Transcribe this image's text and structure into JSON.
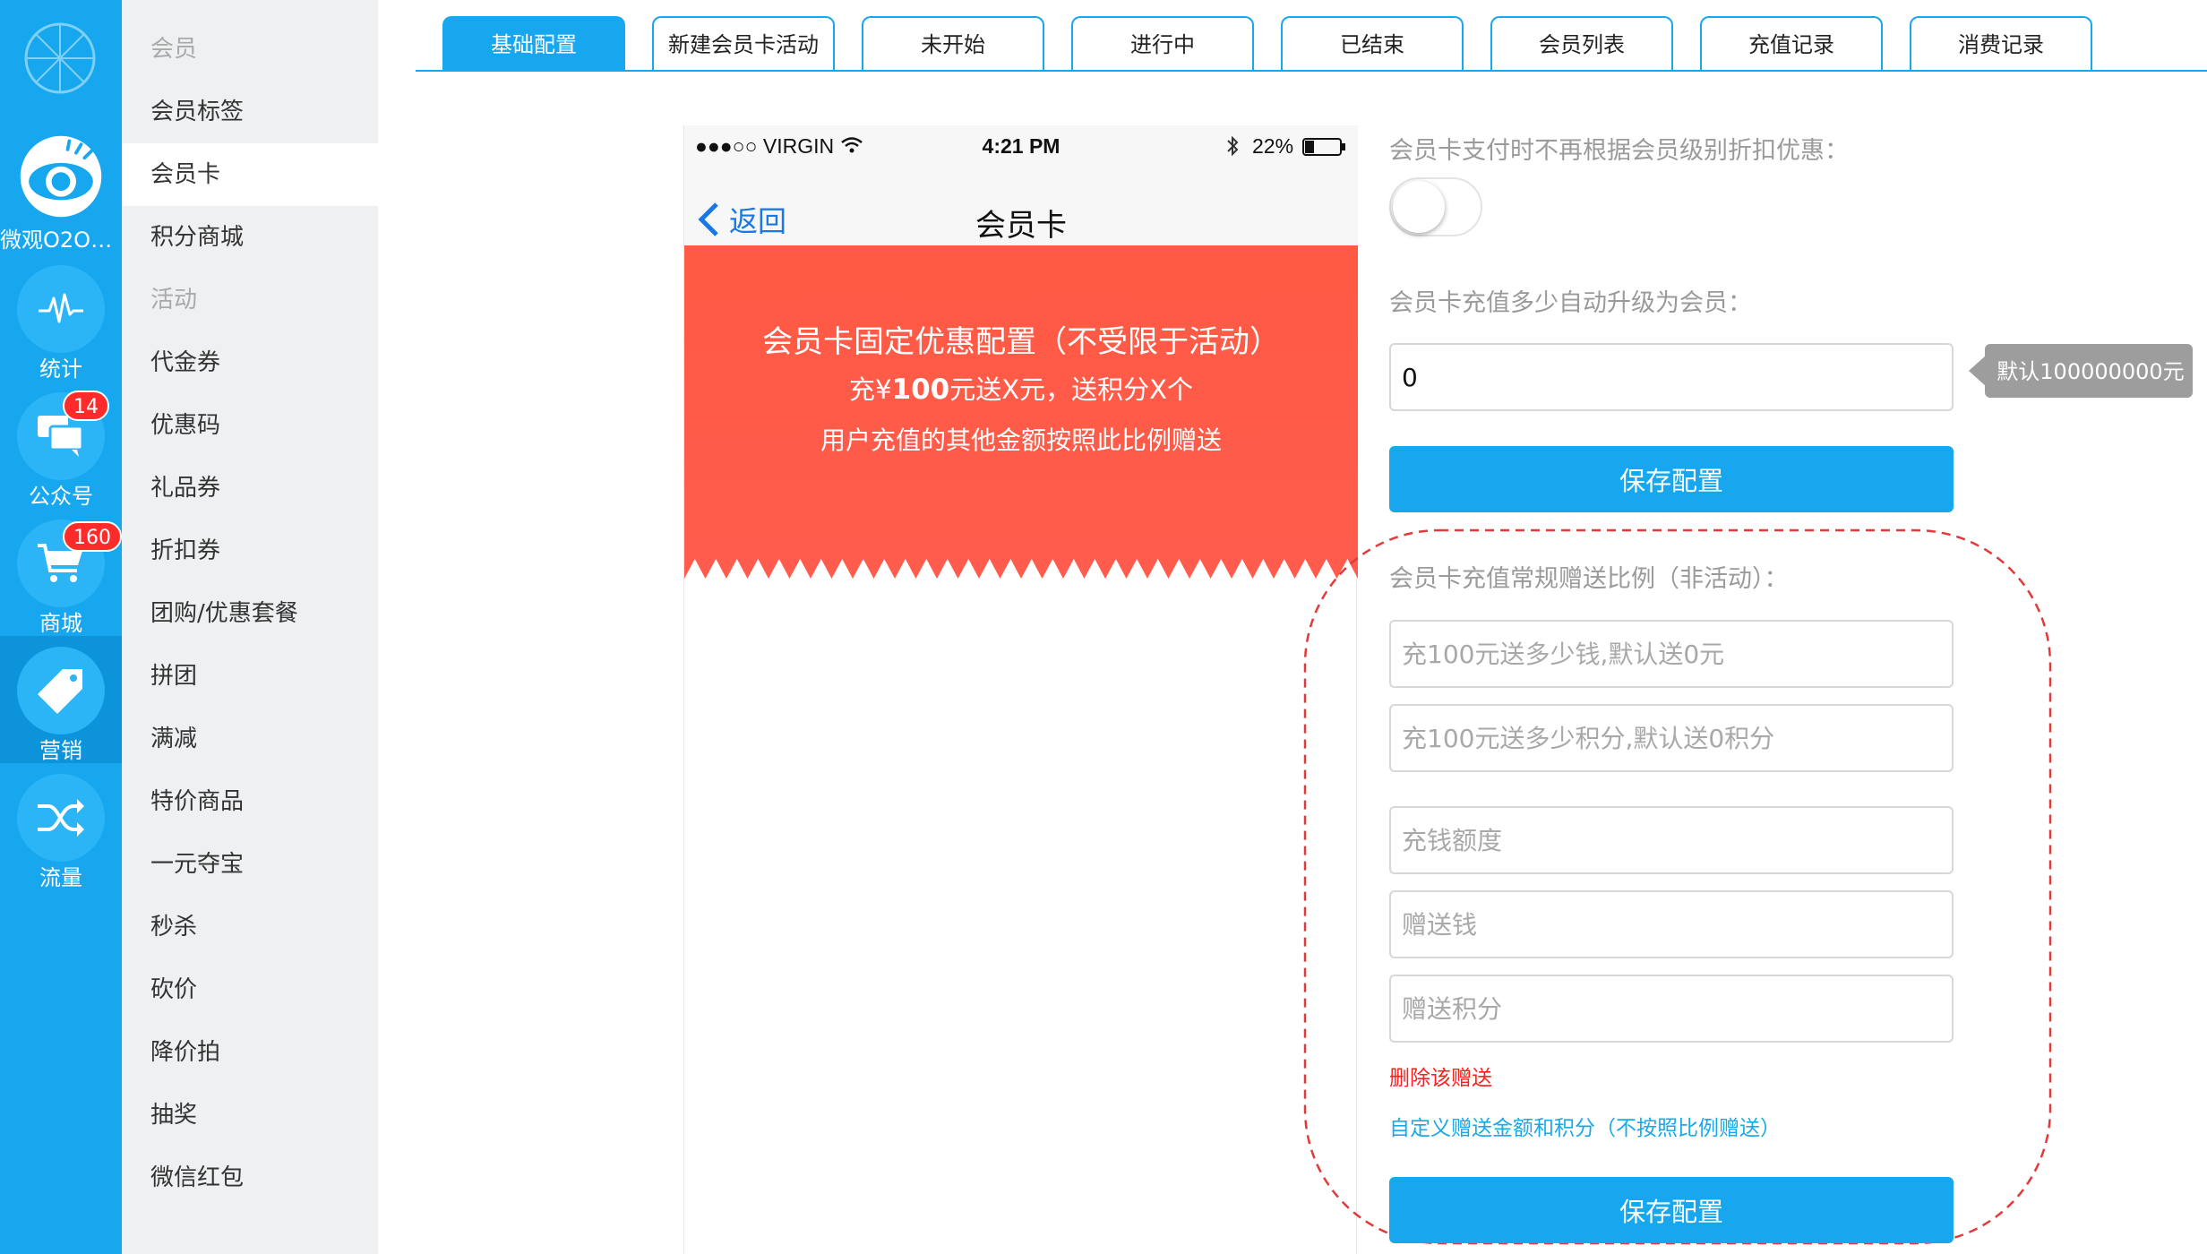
{
  "rail": {
    "store_label": "微观O2O商...",
    "items": [
      {
        "label": "统计",
        "icon": "pulse-icon"
      },
      {
        "label": "公众号",
        "icon": "chat-bubbles-icon",
        "badge": "14"
      },
      {
        "label": "商城",
        "icon": "shopping-cart-icon",
        "badge": "160"
      },
      {
        "label": "营销",
        "icon": "price-tag-icon"
      },
      {
        "label": "流量",
        "icon": "shuffle-icon"
      }
    ]
  },
  "menu": {
    "group_member": "会员",
    "items_member": [
      "会员标签",
      "会员卡",
      "积分商城"
    ],
    "group_activity": "活动",
    "items_activity": [
      "代金券",
      "优惠码",
      "礼品券",
      "折扣券",
      "团购/优惠套餐",
      "拼团",
      "满减",
      "特价商品",
      "一元夺宝",
      "秒杀",
      "砍价",
      "降价拍",
      "抽奖",
      "微信红包"
    ]
  },
  "tabs": [
    "基础配置",
    "新建会员卡活动",
    "未开始",
    "进行中",
    "已结束",
    "会员列表",
    "充值记录",
    "消费记录"
  ],
  "phone": {
    "carrier": "●●●○○ VIRGIN",
    "time": "4:21 PM",
    "battery": "22%",
    "back_label": "返回",
    "title": "会员卡",
    "banner_title": "会员卡固定优惠配置（不受限于活动）",
    "banner_line2_prefix": "充¥",
    "banner_line2_amount": "100",
    "banner_line2_suffix": "元送X元，送积分X个",
    "banner_line3": "用户充值的其他金额按照此比例赠送"
  },
  "form": {
    "no_discount_label": "会员卡支付时不再根据会员级别折扣优惠：",
    "upgrade_label": "会员卡充值多少自动升级为会员：",
    "upgrade_value": "0",
    "upgrade_hint": "默认100000000元",
    "save_label": "保存配置",
    "ratio_label": "会员卡充值常规赠送比例（非活动）：",
    "gift_money_placeholder": "充100元送多少钱,默认送0元",
    "gift_points_placeholder": "充100元送多少积分,默认送0积分",
    "amount_placeholder": "充钱额度",
    "give_money_placeholder": "赠送钱",
    "give_points_placeholder": "赠送积分",
    "delete_link": "删除该赠送",
    "custom_link": "自定义赠送金额和积分（不按照比例赠送）",
    "save_label_2": "保存配置"
  },
  "colors": {
    "primary": "#17a7ee",
    "banner": "#ff5a46",
    "danger": "#ff1e1e",
    "link": "#1aa9e8"
  }
}
